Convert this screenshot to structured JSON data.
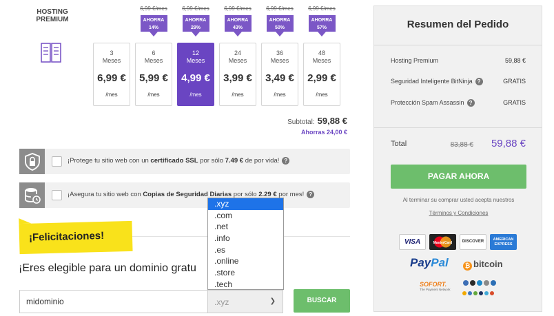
{
  "plan": {
    "title_line1": "HOSTING",
    "title_line2": "PREMIUM",
    "icon": "server-icon"
  },
  "periods": [
    {
      "old_price": "6,99 €/mes",
      "save_label": "AHORRA",
      "save_pct": "14%",
      "months": "6",
      "months_label": "Meses",
      "price": "5,99 €",
      "per": "/mes"
    },
    {
      "old_price": "6,99 €/mes",
      "save_label": "AHORRA",
      "save_pct": "29%",
      "months": "12",
      "months_label": "Meses",
      "price": "4,99 €",
      "per": "/mes"
    },
    {
      "old_price": "6,99 €/mes",
      "save_label": "AHORRA",
      "save_pct": "43%",
      "months": "24",
      "months_label": "Meses",
      "price": "3,99 €",
      "per": "/mes"
    },
    {
      "old_price": "6,99 €/mes",
      "save_label": "AHORRA",
      "save_pct": "50%",
      "months": "36",
      "months_label": "Meses",
      "price": "3,49 €",
      "per": "/mes"
    },
    {
      "old_price": "6,99 €/mes",
      "save_label": "AHORRA",
      "save_pct": "57%",
      "months": "48",
      "months_label": "Meses",
      "price": "2,99 €",
      "per": "/mes"
    }
  ],
  "first_period": {
    "months": "3",
    "months_label": "Meses",
    "price": "6,99 €",
    "per": "/mes"
  },
  "selected_period": "12",
  "subtotal": {
    "label": "Subtotal:",
    "value": "59,88 €",
    "savings": "Ahorras 24,00 €"
  },
  "addons": {
    "ssl": {
      "pre": "¡Protege tu sitio web con un ",
      "bold": "certificado SSL",
      "mid": " por sólo ",
      "price": "7.49 €",
      "post": " de por vida!",
      "icon": "lock-shield-icon"
    },
    "backup": {
      "pre": "¡Asegura tu sitio web con ",
      "bold": "Copias de Seguridad Diarias",
      "mid": " por sólo ",
      "price": "2.29 €",
      "post": " por mes!",
      "icon": "database-backup-icon"
    }
  },
  "domain": {
    "congrats": "¡Felicitaciones!",
    "eligible_text": "¡Eres elegible para un dominio gratu",
    "input_value": "midominio",
    "tld_selected": ".xyz",
    "tld_options": [
      ".xyz",
      ".com",
      ".net",
      ".info",
      ".es",
      ".online",
      ".store",
      ".tech"
    ],
    "search_button": "BUSCAR"
  },
  "summary": {
    "title": "Resumen del Pedido",
    "lines": [
      {
        "label": "Hosting Premium",
        "value": "59,88 €"
      },
      {
        "label": "Seguridad Inteligente BitNinja",
        "value": "GRATIS"
      },
      {
        "label": "Protección Spam Assassin",
        "value": "GRATIS"
      }
    ],
    "total_label": "Total",
    "total_old": "83,88 €",
    "total_new": "59,88 €",
    "pay_button": "PAGAR AHORA",
    "terms_note": "Al terminar su comprar usted acepta nuestros",
    "terms_link": "Términos y Condiciones"
  },
  "payments": {
    "visa": "VISA",
    "mastercard": "MasterCard",
    "discover": "DISCOVER",
    "amex": "AMERICAN EXPRESS",
    "paypal_a": "Pay",
    "paypal_b": "Pal",
    "bitcoin": "bitcoin",
    "sofort": "SOFORT.",
    "sofort_sub": "The Payment Network"
  },
  "colors": {
    "purple": "#6a45c2",
    "green": "#6dbe6c",
    "yellow": "#f9e21b",
    "blue_highlight": "#1e73e8"
  }
}
